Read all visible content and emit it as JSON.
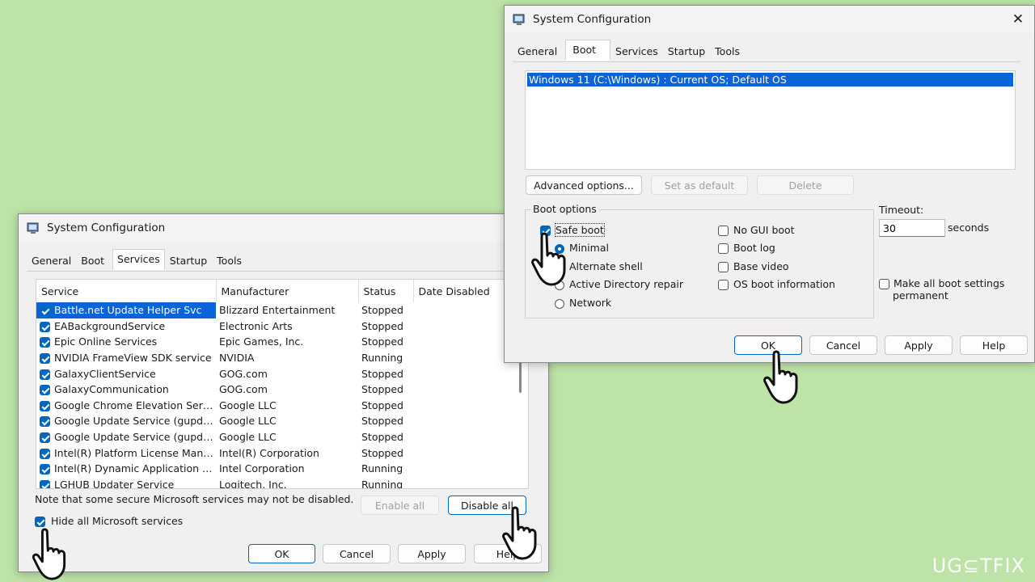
{
  "services_window": {
    "title": "System Configuration",
    "tabs": [
      "General",
      "Boot",
      "Services",
      "Startup",
      "Tools"
    ],
    "active_tab": "Services",
    "columns": [
      "Service",
      "Manufacturer",
      "Status",
      "Date Disabled"
    ],
    "rows": [
      {
        "service": "Battle.net Update Helper Svc",
        "manufacturer": "Blizzard Entertainment",
        "status": "Stopped",
        "checked": true,
        "selected": true
      },
      {
        "service": "EABackgroundService",
        "manufacturer": "Electronic Arts",
        "status": "Stopped",
        "checked": true
      },
      {
        "service": "Epic Online Services",
        "manufacturer": "Epic Games, Inc.",
        "status": "Stopped",
        "checked": true
      },
      {
        "service": "NVIDIA FrameView SDK service",
        "manufacturer": "NVIDIA",
        "status": "Running",
        "checked": true
      },
      {
        "service": "GalaxyClientService",
        "manufacturer": "GOG.com",
        "status": "Stopped",
        "checked": true
      },
      {
        "service": "GalaxyCommunication",
        "manufacturer": "GOG.com",
        "status": "Stopped",
        "checked": true
      },
      {
        "service": "Google Chrome Elevation Servic...",
        "manufacturer": "Google LLC",
        "status": "Stopped",
        "checked": true
      },
      {
        "service": "Google Update Service (gupdate)",
        "manufacturer": "Google LLC",
        "status": "Stopped",
        "checked": true
      },
      {
        "service": "Google Update Service (gupdatem)",
        "manufacturer": "Google LLC",
        "status": "Stopped",
        "checked": true
      },
      {
        "service": "Intel(R) Platform License Manag...",
        "manufacturer": "Intel(R) Corporation",
        "status": "Stopped",
        "checked": true
      },
      {
        "service": "Intel(R) Dynamic Application Loa...",
        "manufacturer": "Intel Corporation",
        "status": "Running",
        "checked": true
      },
      {
        "service": "LGHUB Updater Service",
        "manufacturer": "Logitech, Inc.",
        "status": "Running",
        "checked": true
      }
    ],
    "note": "Note that some secure Microsoft services may not be disabled.",
    "enable_all": "Enable all",
    "disable_all": "Disable all",
    "hide_ms": "Hide all Microsoft services",
    "ok": "OK",
    "cancel": "Cancel",
    "apply": "Apply",
    "help": "Help"
  },
  "boot_window": {
    "title": "System Configuration",
    "close": "✕",
    "tabs": [
      "General",
      "Boot",
      "Services",
      "Startup",
      "Tools"
    ],
    "active_tab": "Boot",
    "os_entry": "Windows 11 (C:\\Windows) : Current OS; Default OS",
    "advanced": "Advanced options...",
    "set_default": "Set as default",
    "delete": "Delete",
    "boot_options_label": "Boot options",
    "safe_boot": "Safe boot",
    "minimal": "Minimal",
    "alternate_shell": "Alternate shell",
    "ad_repair": "Active Directory repair",
    "network": "Network",
    "no_gui": "No GUI boot",
    "boot_log": "Boot log",
    "base_video": "Base video",
    "os_boot_info": "OS boot information",
    "timeout_label": "Timeout:",
    "timeout_value": "30",
    "seconds": "seconds",
    "make_permanent_1": "Make all boot settings",
    "make_permanent_2": "permanent",
    "ok": "OK",
    "cancel": "Cancel",
    "apply": "Apply",
    "help": "Help"
  },
  "watermark": "UG⊆TFIX",
  "colors": {
    "background": "#bde3a8",
    "accent": "#0067c0",
    "selection": "#0a64d8"
  }
}
